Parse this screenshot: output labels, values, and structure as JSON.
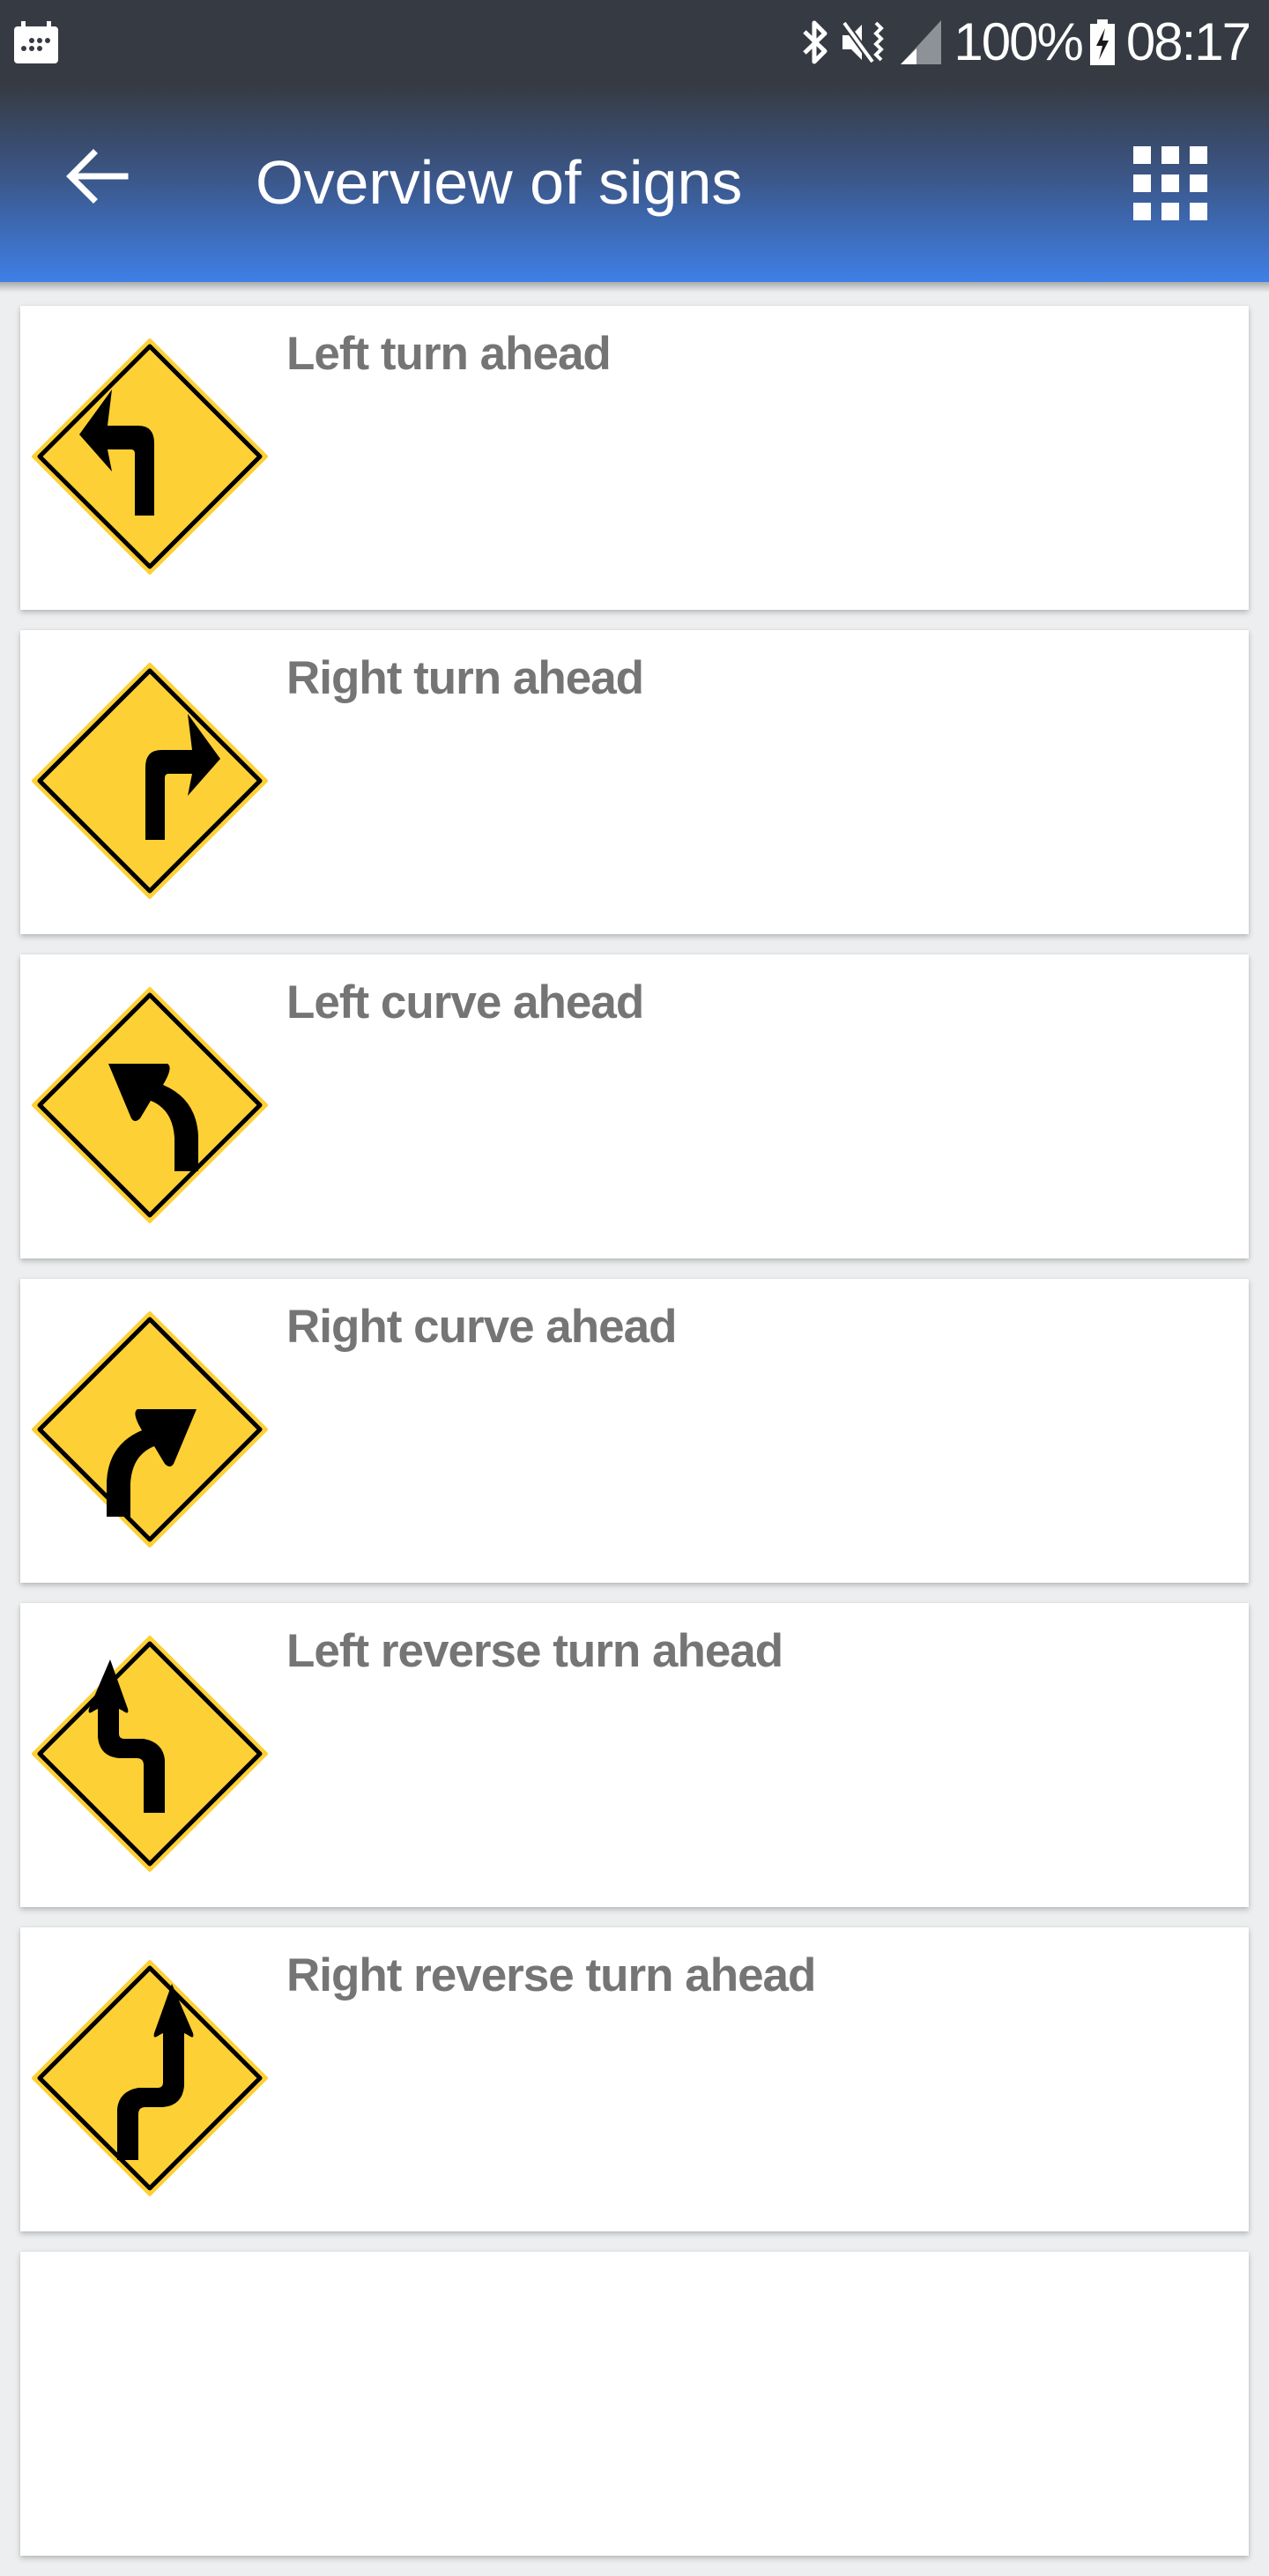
{
  "status_bar": {
    "left_icon": "calendar-icon",
    "icons": [
      "bluetooth-icon",
      "vibrate-mute-icon",
      "signal-icon",
      "battery-charging-icon"
    ],
    "battery": "100%",
    "time": "08:17"
  },
  "app_bar": {
    "back_icon": "arrow-back-icon",
    "title": "Overview of signs",
    "grid_icon": "grid-view-icon"
  },
  "colors": {
    "sign_yellow": "#fdd035",
    "sign_black": "#000000",
    "label_gray": "#757575",
    "appbar_top": "#363b43",
    "appbar_bottom": "#3f7fe6"
  },
  "signs": [
    {
      "label": "Left turn ahead",
      "icon": "left-turn-sign-icon"
    },
    {
      "label": "Right turn ahead",
      "icon": "right-turn-sign-icon"
    },
    {
      "label": "Left curve ahead",
      "icon": "left-curve-sign-icon"
    },
    {
      "label": "Right curve ahead",
      "icon": "right-curve-sign-icon"
    },
    {
      "label": "Left reverse turn ahead",
      "icon": "left-reverse-turn-sign-icon"
    },
    {
      "label": "Right reverse turn ahead",
      "icon": "right-reverse-turn-sign-icon"
    }
  ]
}
